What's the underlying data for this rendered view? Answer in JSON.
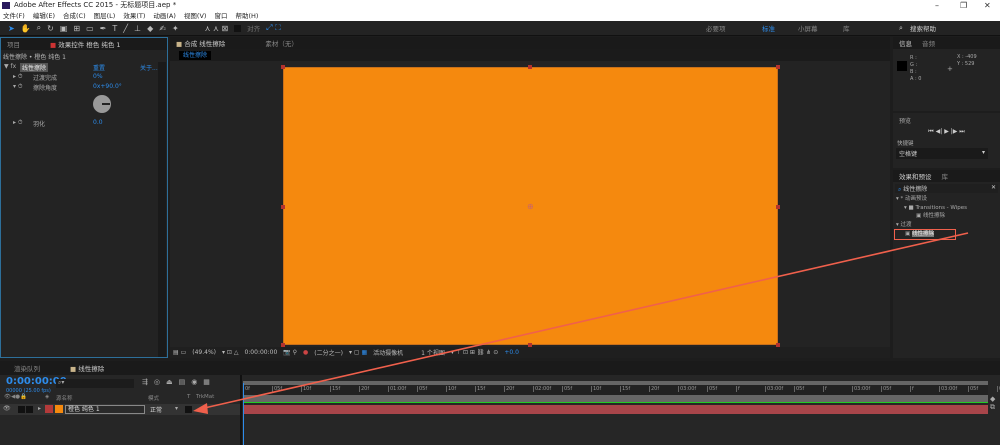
{
  "app": {
    "title": "Adobe After Effects CC 2015 - 无标题项目.aep *",
    "icon": "ae-logo-icon"
  },
  "menu": [
    "文件(F)",
    "编辑(E)",
    "合成(C)",
    "图层(L)",
    "效果(T)",
    "动画(A)",
    "视图(V)",
    "窗口",
    "帮助(H)"
  ],
  "toolbar": {
    "snap_label": "对齐",
    "workspaces": [
      "必要项",
      "标准",
      "小屏幕",
      "库"
    ],
    "active_workspace": "标准",
    "search_placeholder": "搜索帮助"
  },
  "left_panel": {
    "tabs": [
      "项目",
      "效果控件 橙色 纯色 1"
    ],
    "breadcrumb": "线性擦除 • 橙色 纯色 1",
    "effect_name": "线性擦除",
    "reset": "重置",
    "about": "关于...",
    "properties": [
      {
        "name": "过渡完成",
        "value": "0%"
      },
      {
        "name": "擦除角度",
        "value": "0x+90.0°"
      },
      {
        "name": "羽化",
        "value": "0.0"
      }
    ]
  },
  "comp": {
    "tabs": [
      "合成 线性擦除",
      "素材（无）"
    ],
    "comp_chip": "线性擦除",
    "layer_color": "#f5890e",
    "status": {
      "zoom": "(49.4%)",
      "time": "0:00:00:00",
      "resolution": "(二分之一)",
      "camera": "活动摄像机",
      "views": "1 个视图",
      "exposure": "+0.0"
    }
  },
  "info": {
    "tabs": [
      "信息",
      "音频"
    ],
    "r": "R :",
    "g": "G :",
    "b": "B :",
    "a": "A : 0",
    "x": "X : -409",
    "y": "Y : 529"
  },
  "preview": {
    "title": "预览",
    "shortcut_label": "快捷键",
    "shortcut_value": "空格键"
  },
  "effects": {
    "tabs": [
      "效果和预设",
      "库"
    ],
    "search": "线性擦除",
    "tree": [
      {
        "label": "* 动画预设",
        "level": 0
      },
      {
        "label": "Transitions - Wipes",
        "level": 1
      },
      {
        "label": "线性擦除",
        "level": 2
      },
      {
        "label": "过渡",
        "level": 0
      },
      {
        "label": "线性擦除",
        "level": 1,
        "highlighted": true
      }
    ]
  },
  "timeline": {
    "tabs": [
      "渲染队列",
      "线性擦除"
    ],
    "timecode": "0:00:00:00",
    "fps": "00000 (25.00 fps)",
    "columns": {
      "source": "源名称",
      "mode": "模式",
      "t": "T",
      "trkmat": "TrkMat"
    },
    "layer": {
      "name": "橙色 纯色 1",
      "mode": "正常"
    },
    "ticks": [
      "0f",
      "05f",
      "10f",
      "15f",
      "20f",
      "01:00f",
      "05f",
      "10f",
      "15f",
      "20f",
      "02:00f",
      "05f",
      "10f",
      "15f",
      "20f",
      "03:00f",
      "05f",
      "f",
      "03:00f",
      "05f",
      "f",
      "03:00f",
      "05f",
      "f",
      "03:00f",
      "05f",
      "05:00"
    ]
  },
  "colors": {
    "accent": "#2d8ceb",
    "annotation": "#f0604c",
    "layer_bar": "#a8454a"
  }
}
